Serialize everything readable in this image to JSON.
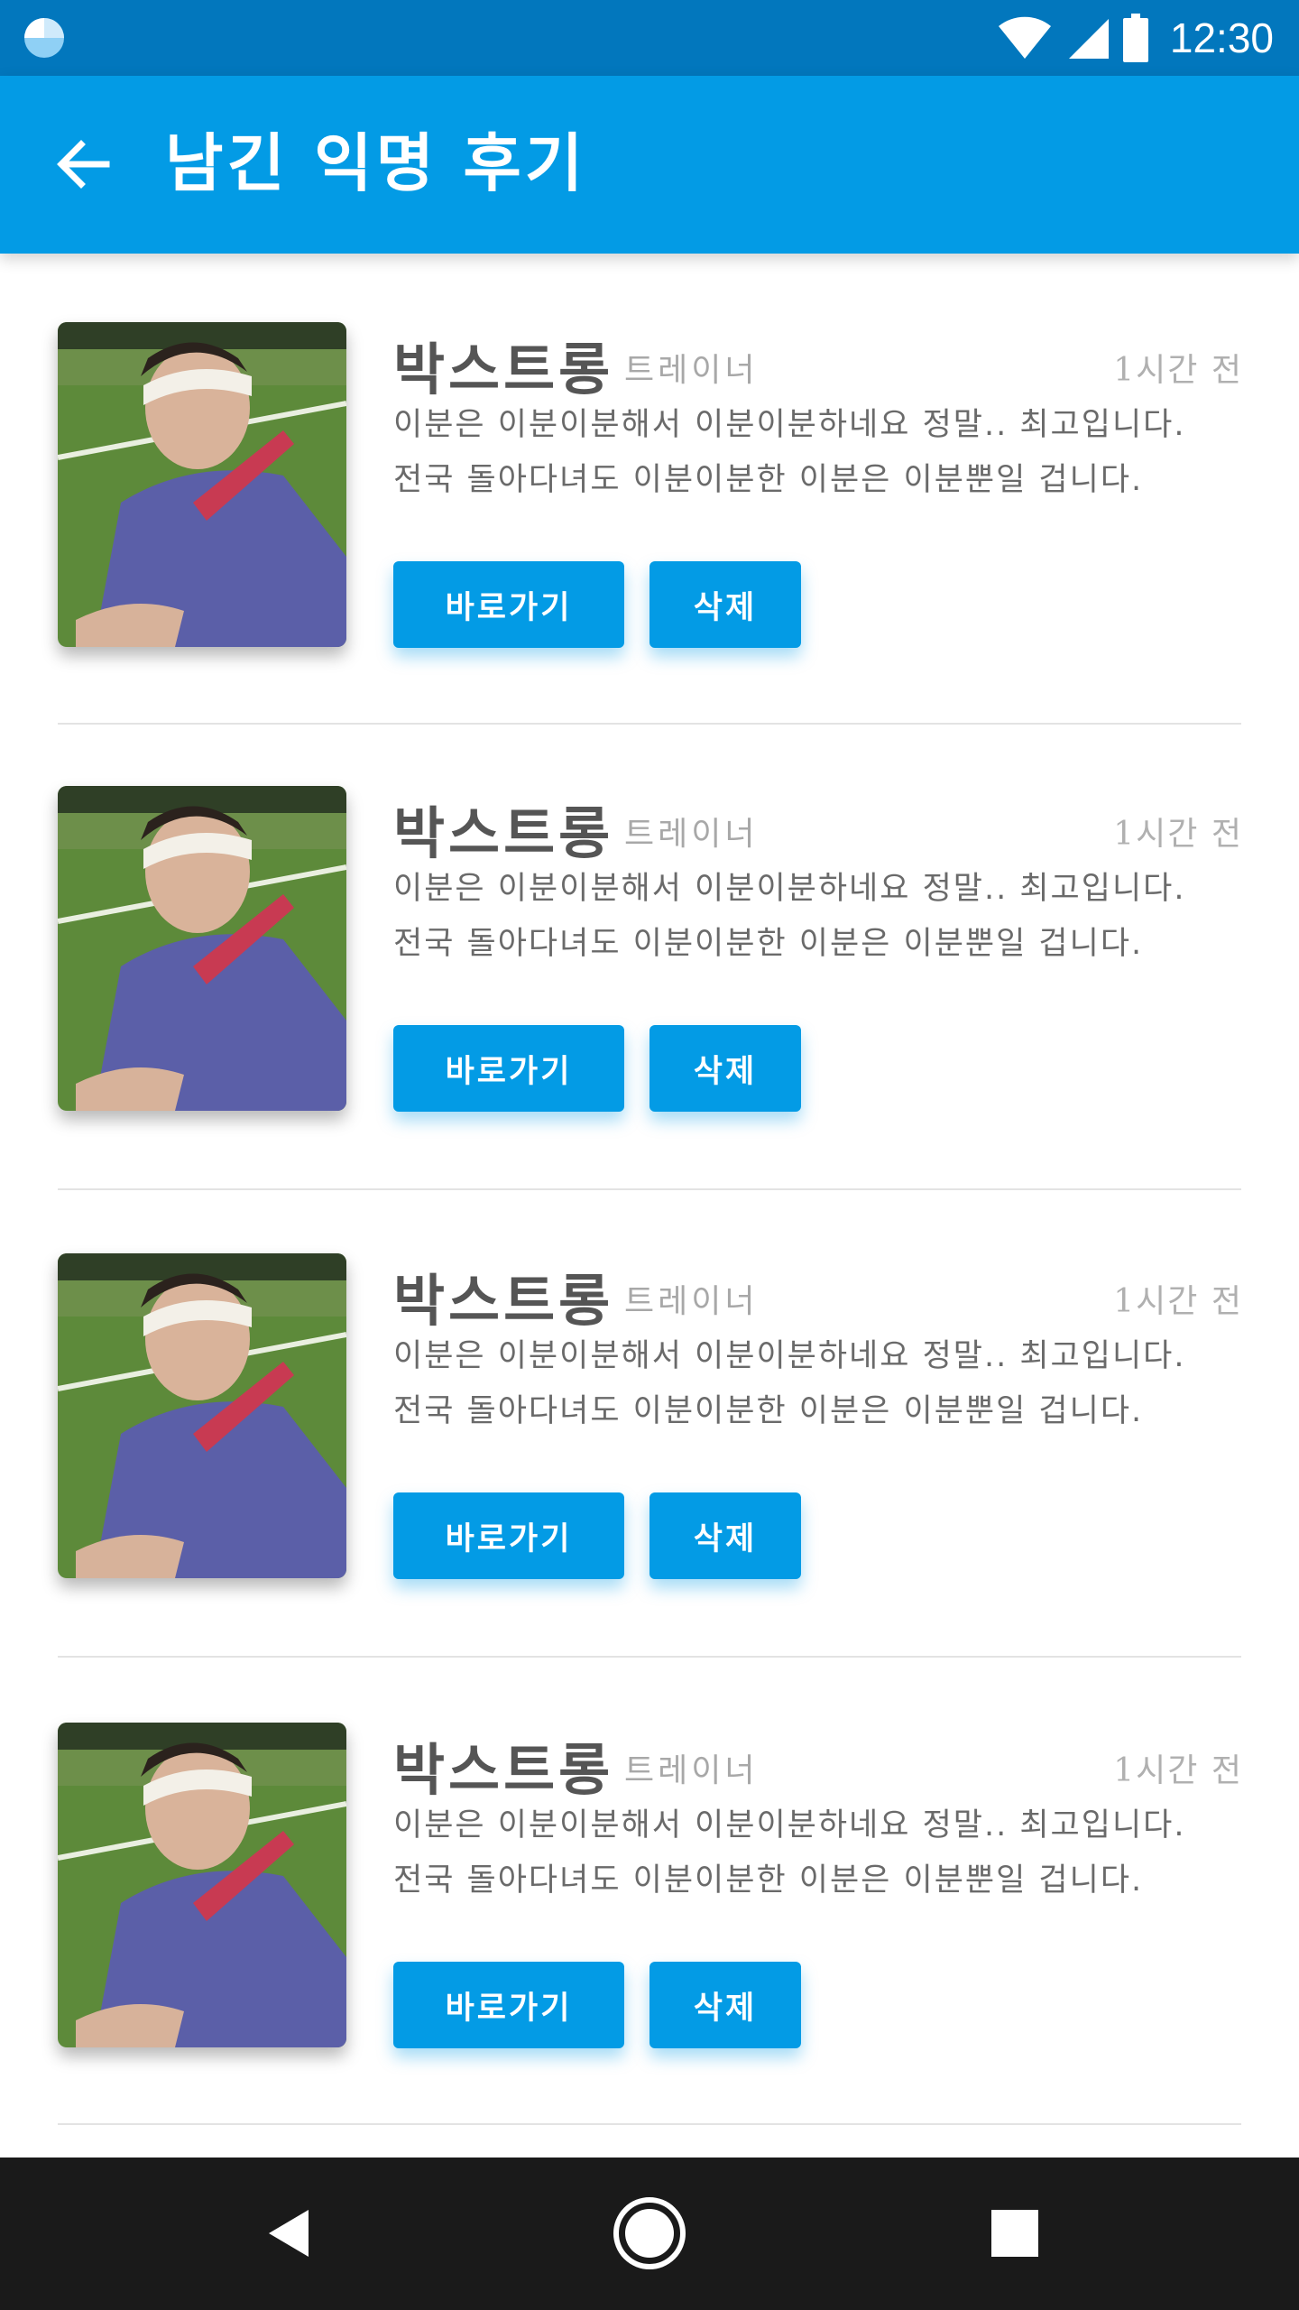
{
  "status_bar": {
    "time": "12:30",
    "icons": [
      "app-logo-icon",
      "wifi-icon",
      "signal-icon",
      "battery-icon"
    ]
  },
  "header": {
    "back_icon": "arrow-left-icon",
    "title": "남긴 익명 후기"
  },
  "reviews": [
    {
      "name": "박스트롱",
      "role": "트레이너",
      "time": "1시간 전",
      "line1": "이분은 이분이분해서 이분이분하네요 정말.. 최고입니다.",
      "line2": "전국 돌아다녀도 이분이분한 이분은 이분뿐일 겁니다.",
      "go_label": "바로가기",
      "delete_label": "삭제"
    },
    {
      "name": "박스트롱",
      "role": "트레이너",
      "time": "1시간 전",
      "line1": "이분은 이분이분해서 이분이분하네요 정말.. 최고입니다.",
      "line2": "전국 돌아다녀도 이분이분한 이분은 이분뿐일 겁니다.",
      "go_label": "바로가기",
      "delete_label": "삭제"
    },
    {
      "name": "박스트롱",
      "role": "트레이너",
      "time": "1시간 전",
      "line1": "이분은 이분이분해서 이분이분하네요 정말.. 최고입니다.",
      "line2": "전국 돌아다녀도 이분이분한 이분은 이분뿐일 겁니다.",
      "go_label": "바로가기",
      "delete_label": "삭제"
    },
    {
      "name": "박스트롱",
      "role": "트레이너",
      "time": "1시간 전",
      "line1": "이분은 이분이분해서 이분이분하네요 정말.. 최고입니다.",
      "line2": "전국 돌아다녀도 이분이분한 이분은 이분뿐일 겁니다.",
      "go_label": "바로가기",
      "delete_label": "삭제"
    }
  ],
  "nav_bar": {
    "icons": [
      "back-triangle-icon",
      "home-circle-icon",
      "recents-square-icon"
    ]
  },
  "colors": {
    "status_bar": "#0277bd",
    "app_bar": "#039be5",
    "button": "#039be5",
    "nav_bar": "#1a1a1a"
  }
}
